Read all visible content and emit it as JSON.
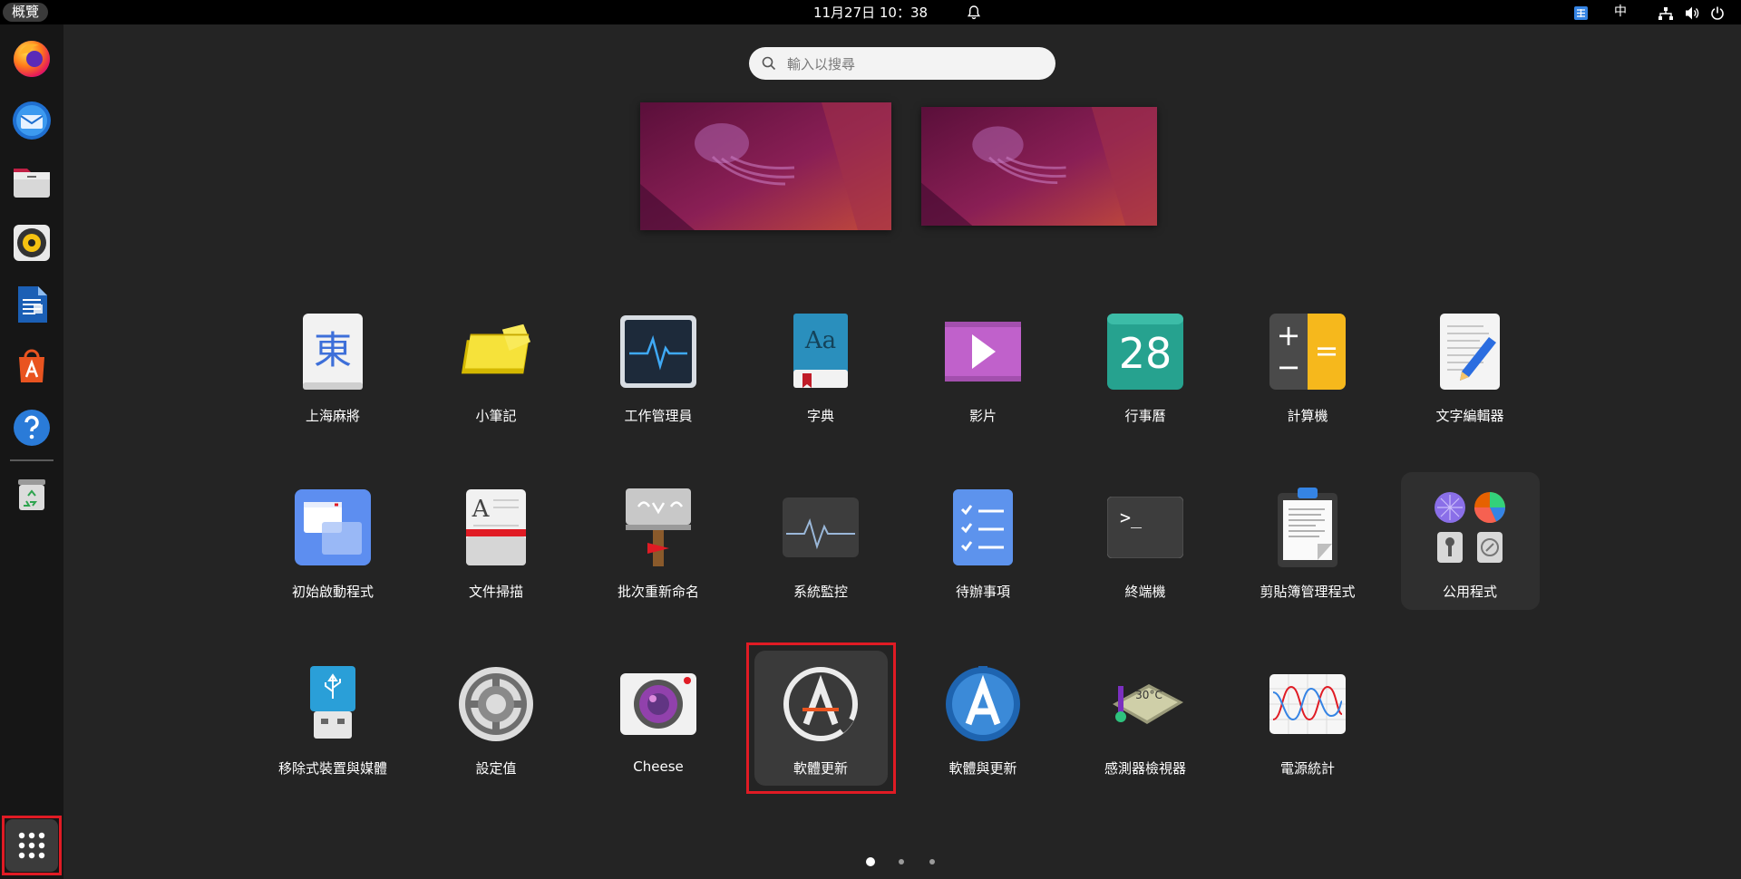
{
  "topbar": {
    "activities": "概覽",
    "clock": "11月27日 10：38",
    "tray": {
      "input_method": "中"
    }
  },
  "dock": {
    "items": [
      {
        "name": "firefox"
      },
      {
        "name": "thunderbird"
      },
      {
        "name": "files"
      },
      {
        "name": "rhythmbox"
      },
      {
        "name": "libreoffice-writer"
      },
      {
        "name": "ubuntu-software"
      },
      {
        "name": "help"
      },
      {
        "name": "trash"
      }
    ]
  },
  "search": {
    "placeholder": "輸入以搜尋"
  },
  "apps": {
    "row1": [
      "上海麻將",
      "小筆記",
      "工作管理員",
      "字典",
      "影片",
      "行事曆",
      "計算機",
      "文字編輯器"
    ],
    "row2": [
      "初始啟動程式",
      "文件掃描",
      "批次重新命名",
      "系統監控",
      "待辦事項",
      "終端機",
      "剪貼簿管理程式",
      "公用程式"
    ],
    "row3": [
      "移除式裝置與媒體",
      "設定值",
      "Cheese",
      "軟體更新",
      "軟體與更新",
      "感測器檢視器",
      "電源統計"
    ]
  },
  "icon_text": {
    "mahjong": "東",
    "dictionary": "Aa",
    "calendar": "28",
    "calculator_plus": "+",
    "calculator_minus": "−",
    "calculator_equal": "=",
    "terminal": ">_",
    "scan_letter": "A",
    "sensor_temp": "30°C"
  },
  "pages": {
    "count": 3,
    "current": 0
  },
  "colors": {
    "accent_selection": "#e01b24",
    "background": "#242424"
  }
}
